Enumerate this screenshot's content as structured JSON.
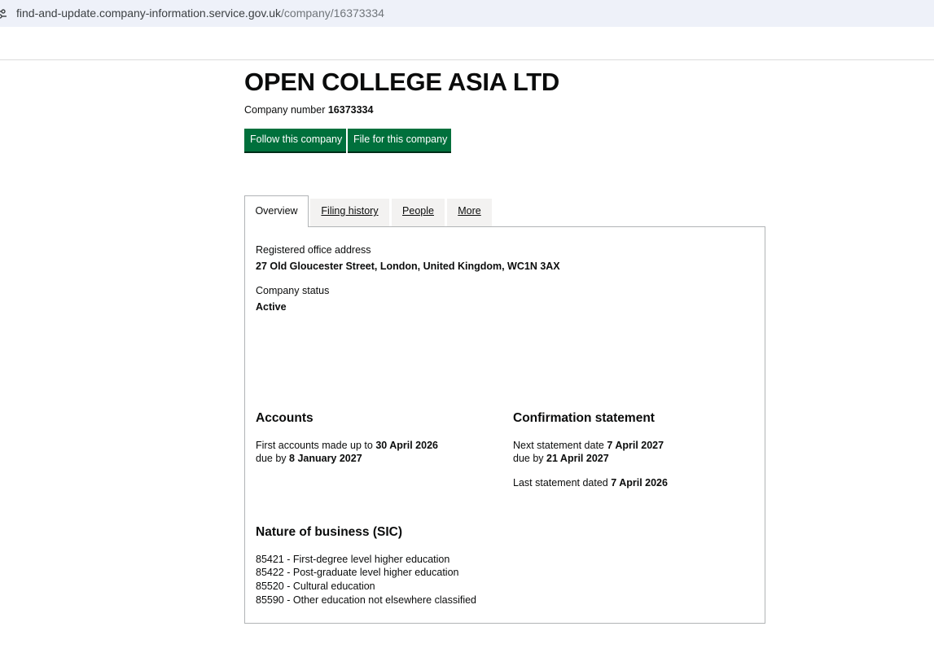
{
  "browser": {
    "url_host": "find-and-update.company-information.service.gov.uk",
    "url_path": "/company/16373334"
  },
  "company": {
    "name": "OPEN COLLEGE ASIA LTD",
    "number_label": "Company number",
    "number": "16373334"
  },
  "actions": {
    "follow_label": "Follow this company",
    "file_label": "File for this company"
  },
  "tabs": [
    {
      "label": "Overview",
      "active": true
    },
    {
      "label": "Filing history",
      "active": false
    },
    {
      "label": "People",
      "active": false
    },
    {
      "label": "More",
      "active": false
    }
  ],
  "overview": {
    "address_label": "Registered office address",
    "address_value": "27 Old Gloucester Street, London, United Kingdom, WC1N 3AX",
    "status_label": "Company status",
    "status_value": "Active",
    "accounts": {
      "heading": "Accounts",
      "line1_prefix": "First accounts made up to",
      "line1_date": "30 April 2026",
      "line2_prefix": "due by",
      "line2_date": "8 January 2027"
    },
    "confirmation": {
      "heading": "Confirmation statement",
      "next_prefix": "Next statement date",
      "next_date": "7 April 2027",
      "due_prefix": "due by",
      "due_date": "21 April 2027",
      "last_prefix": "Last statement dated",
      "last_date": "7 April 2026"
    },
    "sic": {
      "heading": "Nature of business (SIC)",
      "items": [
        "85421 - First-degree level higher education",
        "85422 - Post-graduate level higher education",
        "85520 - Cultural education",
        "85590 - Other education not elsewhere classified"
      ]
    }
  },
  "colors": {
    "button_green": "#00703c",
    "tab_inactive_bg": "#f3f2f1",
    "border_grey": "#b1b4b6",
    "url_bar_bg": "#eef1f9"
  },
  "icons": {
    "site_info": "tune-icon"
  }
}
